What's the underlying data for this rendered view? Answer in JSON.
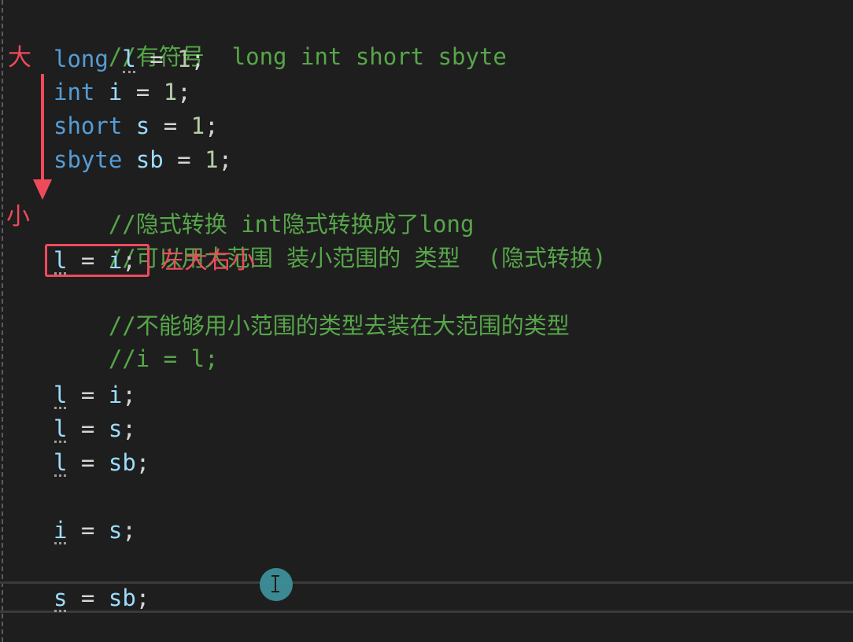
{
  "annotations": {
    "top_label": "大",
    "bottom_label": "小",
    "box_label": "左大右小"
  },
  "code": {
    "l1": {
      "comment": "//有符号  long int short sbyte"
    },
    "l2": {
      "kw": "long",
      "var": "l",
      "op": " = ",
      "num": "1",
      "end": ";"
    },
    "l3": {
      "kw": "int",
      "var": "i",
      "op": " = ",
      "num": "1",
      "end": ";"
    },
    "l4": {
      "kw": "short",
      "var": "s",
      "op": " = ",
      "num": "1",
      "end": ";"
    },
    "l5": {
      "kw": "sbyte",
      "var": "sb",
      "op": " = ",
      "num": "1",
      "end": ";"
    },
    "l6": {
      "comment": "//隐式转换 int隐式转换成了long"
    },
    "l7": {
      "comment": "//可以用大范围 装小范围的 类型  (隐式转换)"
    },
    "l8": {
      "lhs": "l",
      "op": " = ",
      "rhs": "i",
      "end": ";"
    },
    "l9": {
      "comment": "//不能够用小范围的类型去装在大范围的类型"
    },
    "l10": {
      "comment": "//i = l;"
    },
    "l11": {
      "lhs": "l",
      "op": " = ",
      "rhs": "i",
      "end": ";"
    },
    "l12": {
      "lhs": "l",
      "op": " = ",
      "rhs": "s",
      "end": ";"
    },
    "l13": {
      "lhs": "l",
      "op": " = ",
      "rhs": "sb",
      "end": ";"
    },
    "l14": {
      "lhs": "i",
      "op": " = ",
      "rhs": "s",
      "end": ";"
    },
    "l15": {
      "lhs": "s",
      "op": " = ",
      "rhs": "sb",
      "end": ";"
    }
  },
  "colors": {
    "background": "#1e1e1e",
    "keyword": "#569cd6",
    "variable": "#9cdcfe",
    "number": "#b5cea8",
    "comment": "#57a64a",
    "annotation": "#ef4a5c"
  },
  "icons": {
    "cursor": "text-cursor-icon"
  }
}
